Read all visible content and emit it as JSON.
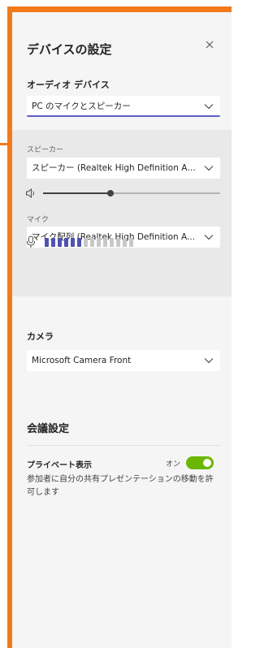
{
  "dialog": {
    "title": "デバイスの設定"
  },
  "audio": {
    "section_label": "オーディオ デバイス",
    "device_value": "PC のマイクとスピーカー",
    "speaker_label": "スピーカー",
    "speaker_value": "スピーカー (Realtek High Definition Aud...",
    "speaker_volume": 0.38,
    "mic_label": "マイク",
    "mic_value": "マイク配列 (Realtek High Definition A...",
    "mic_level_active_bars": 6,
    "mic_level_total_bars": 14
  },
  "camera": {
    "section_label": "カメラ",
    "device_value": "Microsoft Camera Front"
  },
  "meeting": {
    "heading": "会議設定",
    "private_view_label": "プライベート表示",
    "private_view_state": "オン",
    "private_view_on": true,
    "description": "参加者に自分の共有プレゼンテーションの移動を許可します"
  },
  "colors": {
    "frame_accent": "#f27a1a",
    "select_underline": "#5b5fc7",
    "toggle_on": "#6bb700",
    "mic_bar_active": "#4f52b2",
    "mic_bar_inactive": "#c8c8c8"
  },
  "icons": {
    "close": "close-icon",
    "chevron": "chevron-down-icon",
    "speaker": "speaker-icon",
    "mic": "microphone-icon"
  }
}
